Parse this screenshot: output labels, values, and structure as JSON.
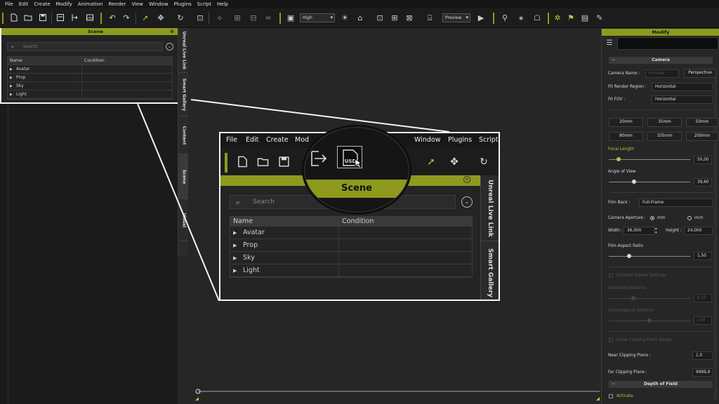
{
  "menu": [
    "File",
    "Edit",
    "Create",
    "Modify",
    "Animation",
    "Render",
    "View",
    "Window",
    "Plugins",
    "Script",
    "Help"
  ],
  "toolbar": {
    "quality": "High",
    "preview": "Preview"
  },
  "scene_panel": {
    "title": "Scene",
    "search_placeholder": "Search",
    "columns": [
      "Name",
      "Condition"
    ],
    "rows": [
      "Avatar",
      "Prop",
      "Sky",
      "Light"
    ]
  },
  "side_tabs": [
    "Unreal Live Link",
    "Smart Gallery",
    "Content",
    "Scene",
    "Visual"
  ],
  "zoom": {
    "menu": [
      "File",
      "Edit",
      "Create",
      "Mod",
      "Window",
      "Plugins",
      "Script"
    ],
    "scene_title": "Scene",
    "usd_label": "USD",
    "search_placeholder": "Search",
    "columns": [
      "Name",
      "Condition"
    ],
    "rows": [
      "Avatar",
      "Prop",
      "Sky",
      "Light"
    ],
    "side_tabs": [
      "Unreal Live Link",
      "Smart Gallery"
    ]
  },
  "modify": {
    "title": "Modify",
    "camera_section": "Camera",
    "camera_name_label": "Camera Name :",
    "camera_name_value": "Preview",
    "camera_projection": "Perspective",
    "fit_render_region_label": "Fit Render Region :",
    "fit_render_region_value": "Horizontal",
    "fit_fov_label": "Fit FOV :",
    "fit_fov_value": "Horizontal",
    "lens_buttons": [
      "20mm",
      "35mm",
      "50mm",
      "80mm",
      "105mm",
      "200mm"
    ],
    "focal_length_label": "Focal Length",
    "focal_length_value": "50,00",
    "focal_length_fraction": 0.12,
    "angle_of_view_label": "Angle of View",
    "angle_of_view_value": "39,60",
    "angle_of_view_fraction": 0.31,
    "film_back_label": "Film Back :",
    "film_back_value": "Full-Frame",
    "camera_aperture_label": "Camera Aperture :",
    "aperture_unit_mm": "mm",
    "aperture_unit_inch": "inch",
    "width_label": "Width :",
    "width_value": "36,000",
    "height_label": "Height :",
    "height_value": "24,000",
    "film_aspect_label": "Film Aspect Ratio",
    "film_aspect_value": "1,50",
    "film_aspect_fraction": 0.25,
    "stereo_label": "Activate Stereo Settings",
    "interaxial_label": "Interaxial Distance",
    "interaxial_value": "6,50",
    "interaxial_fraction": 0.3,
    "convergence_label": "Convergence Distance",
    "convergence_value": "100",
    "convergence_fraction": 0.5,
    "clipping_label": "Show Clipping Plane Range",
    "near_clip_label": "Near Clipping Plane :",
    "near_clip_value": "1,0",
    "far_clip_label": "Far Clipping Plane :",
    "far_clip_value": "9999,9",
    "dof_section": "Depth of Field",
    "activate_label": "Activate"
  },
  "colors": {
    "accent": "#8d9a1e",
    "accent_text": "#b8c43a",
    "background": "#262626"
  }
}
